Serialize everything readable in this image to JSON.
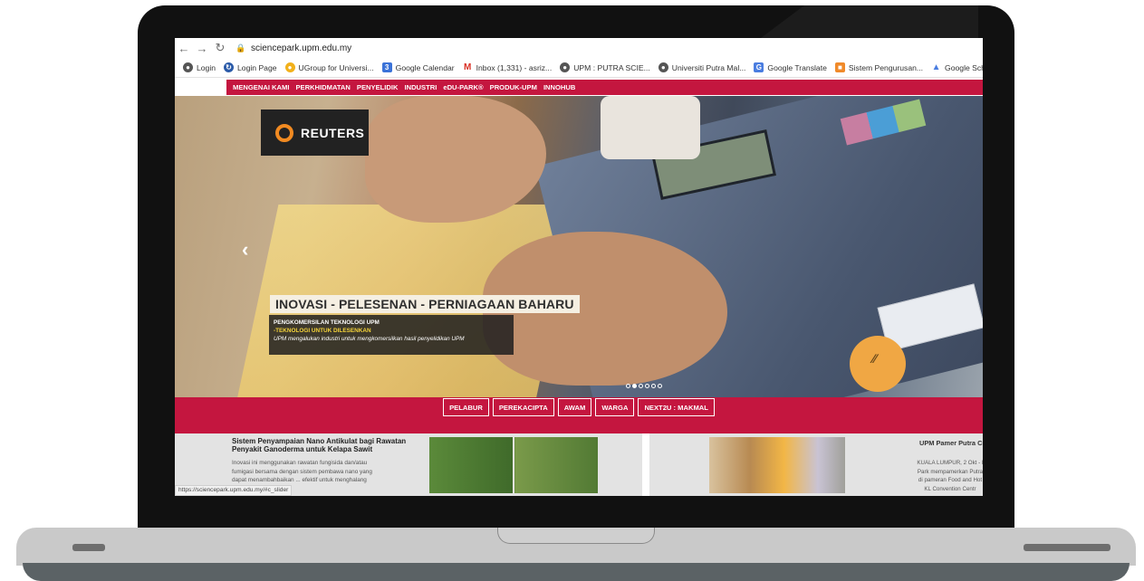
{
  "browser": {
    "url": "sciencepark.upm.edu.my",
    "bookmarks": [
      {
        "label": "Login",
        "icon": "globe-icon"
      },
      {
        "label": "Login Page",
        "icon": "refresh-icon"
      },
      {
        "label": "UGroup for Universi...",
        "icon": "ugroup-icon"
      },
      {
        "label": "Google Calendar",
        "icon": "calendar-icon"
      },
      {
        "label": "Inbox (1,331) - asriz...",
        "icon": "gmail-icon"
      },
      {
        "label": "UPM : PUTRA SCIE...",
        "icon": "globe-icon"
      },
      {
        "label": "Universiti Putra Mal...",
        "icon": "globe-icon"
      },
      {
        "label": "Google Translate",
        "icon": "translate-icon"
      },
      {
        "label": "Sistem Pengurusan...",
        "icon": "system-icon"
      },
      {
        "label": "Google Scholar",
        "icon": "scholar-icon"
      }
    ],
    "status_url": "https://sciencepark.upm.edu.my/#c_slider"
  },
  "nav": [
    "MENGENAI KAMI",
    "PERKHIDMATAN",
    "PENYELIDIK",
    "INDUSTRI",
    "eDU-PARK®",
    "PRODUK-UPM",
    "INNOHUB"
  ],
  "hero": {
    "brand": "REUTERS",
    "headline": "INOVASI - PELESENAN  - PERNIAGAAN BAHARU",
    "caption_line1": "PENGKOMERSILAN TEKNOLOGI UPM",
    "caption_line2": "-TEKNOLOGI UNTUK DILESENKAN",
    "caption_line3": "UPM mengalukan industri  untuk mengkomersilkan hasil penyelidikan UPM",
    "slide_count": 6,
    "active_slide": 2
  },
  "audience_buttons": [
    "PELABUR",
    "PEREKACIPTA",
    "AWAM",
    "WARGA",
    "NEXT2U : MAKMAL"
  ],
  "news": [
    {
      "title": "Sistem Penyampaian Nano Antikulat bagi Rawatan Penyakit Ganoderma untuk Kelapa Sawit",
      "body": "Inovasi ini menggunakan rawatan fungisida dan/atau fumigasi bersama dengan sistem pembawa nano yang dapat menambahbaikan ... efektif untuk menghalang"
    },
    {
      "title": "UPM Pamer Putra Cr",
      "body_lines": [
        "KUALA LUMPUR, 2 Okt - I",
        "Park mempamerkan Putra",
        "di pameran Food and Hot",
        "KL Convention Centr"
      ]
    }
  ],
  "colors": {
    "accent": "#c4163f",
    "caption_highlight": "#f5d43a",
    "reuters_orange": "#f18a21"
  }
}
